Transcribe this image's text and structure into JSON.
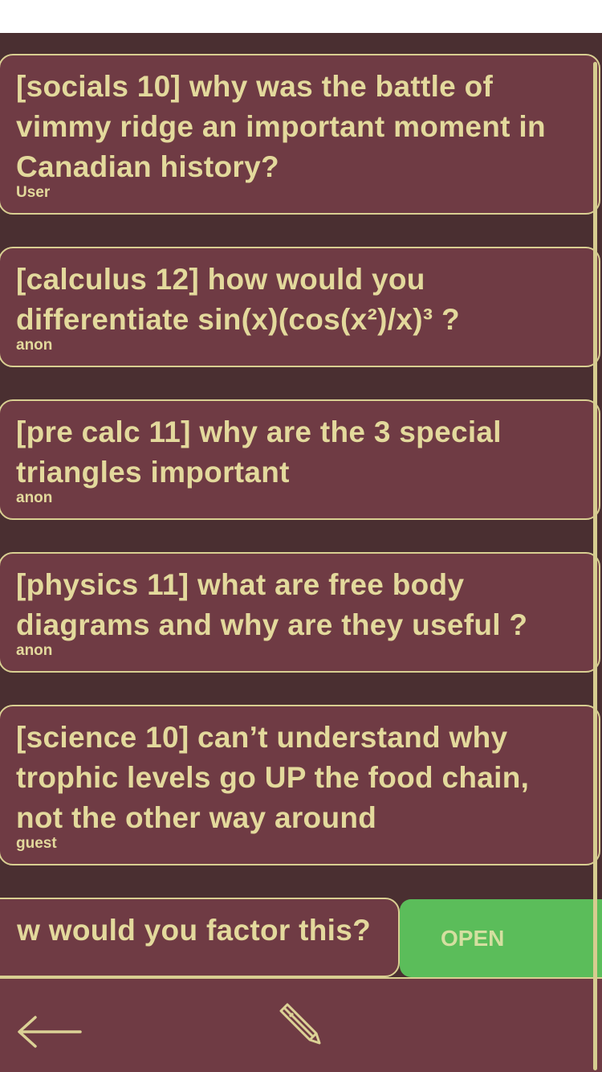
{
  "posts": [
    {
      "title": "[socials 10] why was the battle of vimmy ridge an important moment in Canadian history?",
      "author": "User"
    },
    {
      "title": "[calculus 12] how would you differentiate sin(x)(cos(x²)/x)³ ?",
      "author": "anon"
    },
    {
      "title": "[pre calc 11] why are the 3 special triangles important",
      "author": "anon"
    },
    {
      "title": "[physics 11] what are free body diagrams and why are they useful ?",
      "author": "anon"
    },
    {
      "title": "[science 10] can’t understand why trophic levels go UP the food chain, not the other way around",
      "author": "guest"
    }
  ],
  "swiped_post": {
    "title_visible": "w would you factor this?",
    "action_label": "OPEN"
  },
  "toolbar": {
    "back_icon": "back-arrow-icon",
    "compose_icon": "pencil-icon"
  },
  "colors": {
    "background": "#4a2f31",
    "card": "#6f3b44",
    "text": "#e3d99c",
    "border": "#d9cf92",
    "open_action": "#5bbd5a"
  }
}
